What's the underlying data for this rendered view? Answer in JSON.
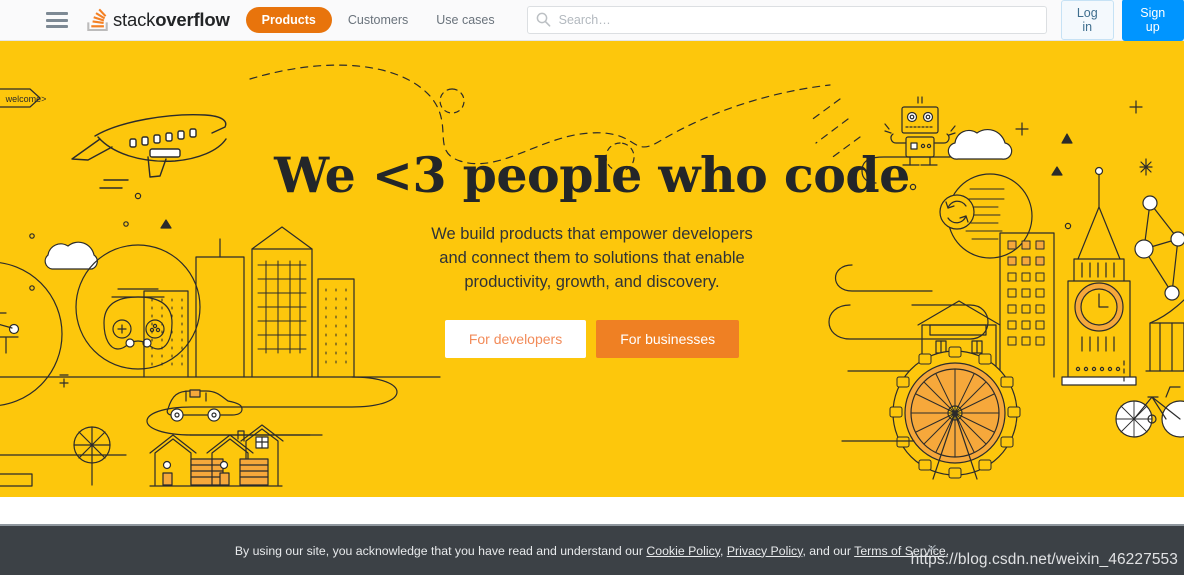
{
  "header": {
    "menu_icon": "hamburger-icon",
    "logo": {
      "text_light": "stack",
      "text_bold": "overflow",
      "icon": "stack-overflow-logo-icon"
    },
    "nav": [
      {
        "label": "Products",
        "active": true
      },
      {
        "label": "Customers",
        "active": false
      },
      {
        "label": "Use cases",
        "active": false
      }
    ],
    "search": {
      "placeholder": "Search…",
      "value": "",
      "icon": "search-icon"
    },
    "login_label": "Log in",
    "signup_label": "Sign up",
    "colors": {
      "pill": "#e8740c",
      "signup": "#0095ff",
      "login_text": "#3f6e8e"
    }
  },
  "hero": {
    "title": "We <3 people who code",
    "subtitle": "We build products that empower developers and connect them to solutions that enable productivity, growth, and discovery.",
    "cta_primary": "For developers",
    "cta_secondary": "For businesses",
    "background_color": "#fdc70c",
    "art": {
      "code_tag_label": "welcome>",
      "elements": [
        "airplane-illustration",
        "cloud-illustration",
        "gamepad-circle-illustration",
        "desk-circle-illustration",
        "city-buildings-illustration",
        "car-illustration",
        "houses-illustration",
        "tree-illustration",
        "robot-illustration",
        "sync-circle-illustration",
        "clock-tower-illustration",
        "ferris-wheel-illustration",
        "network-nodes-illustration",
        "bicycle-illustration",
        "chart-illustration",
        "dashed-path-illustration"
      ]
    }
  },
  "cookie_banner": {
    "text_start": "By using our site, you acknowledge that you have read and understand our ",
    "link_cookie": "Cookie Policy",
    "sep1": ", ",
    "link_privacy": "Privacy Policy",
    "sep2": ", and our ",
    "link_terms": "Terms of Service",
    "text_end": ".",
    "close_label": "×",
    "background_color": "#3c4146"
  },
  "watermark": {
    "text": "https://blog.csdn.net/weixin_46227553"
  }
}
